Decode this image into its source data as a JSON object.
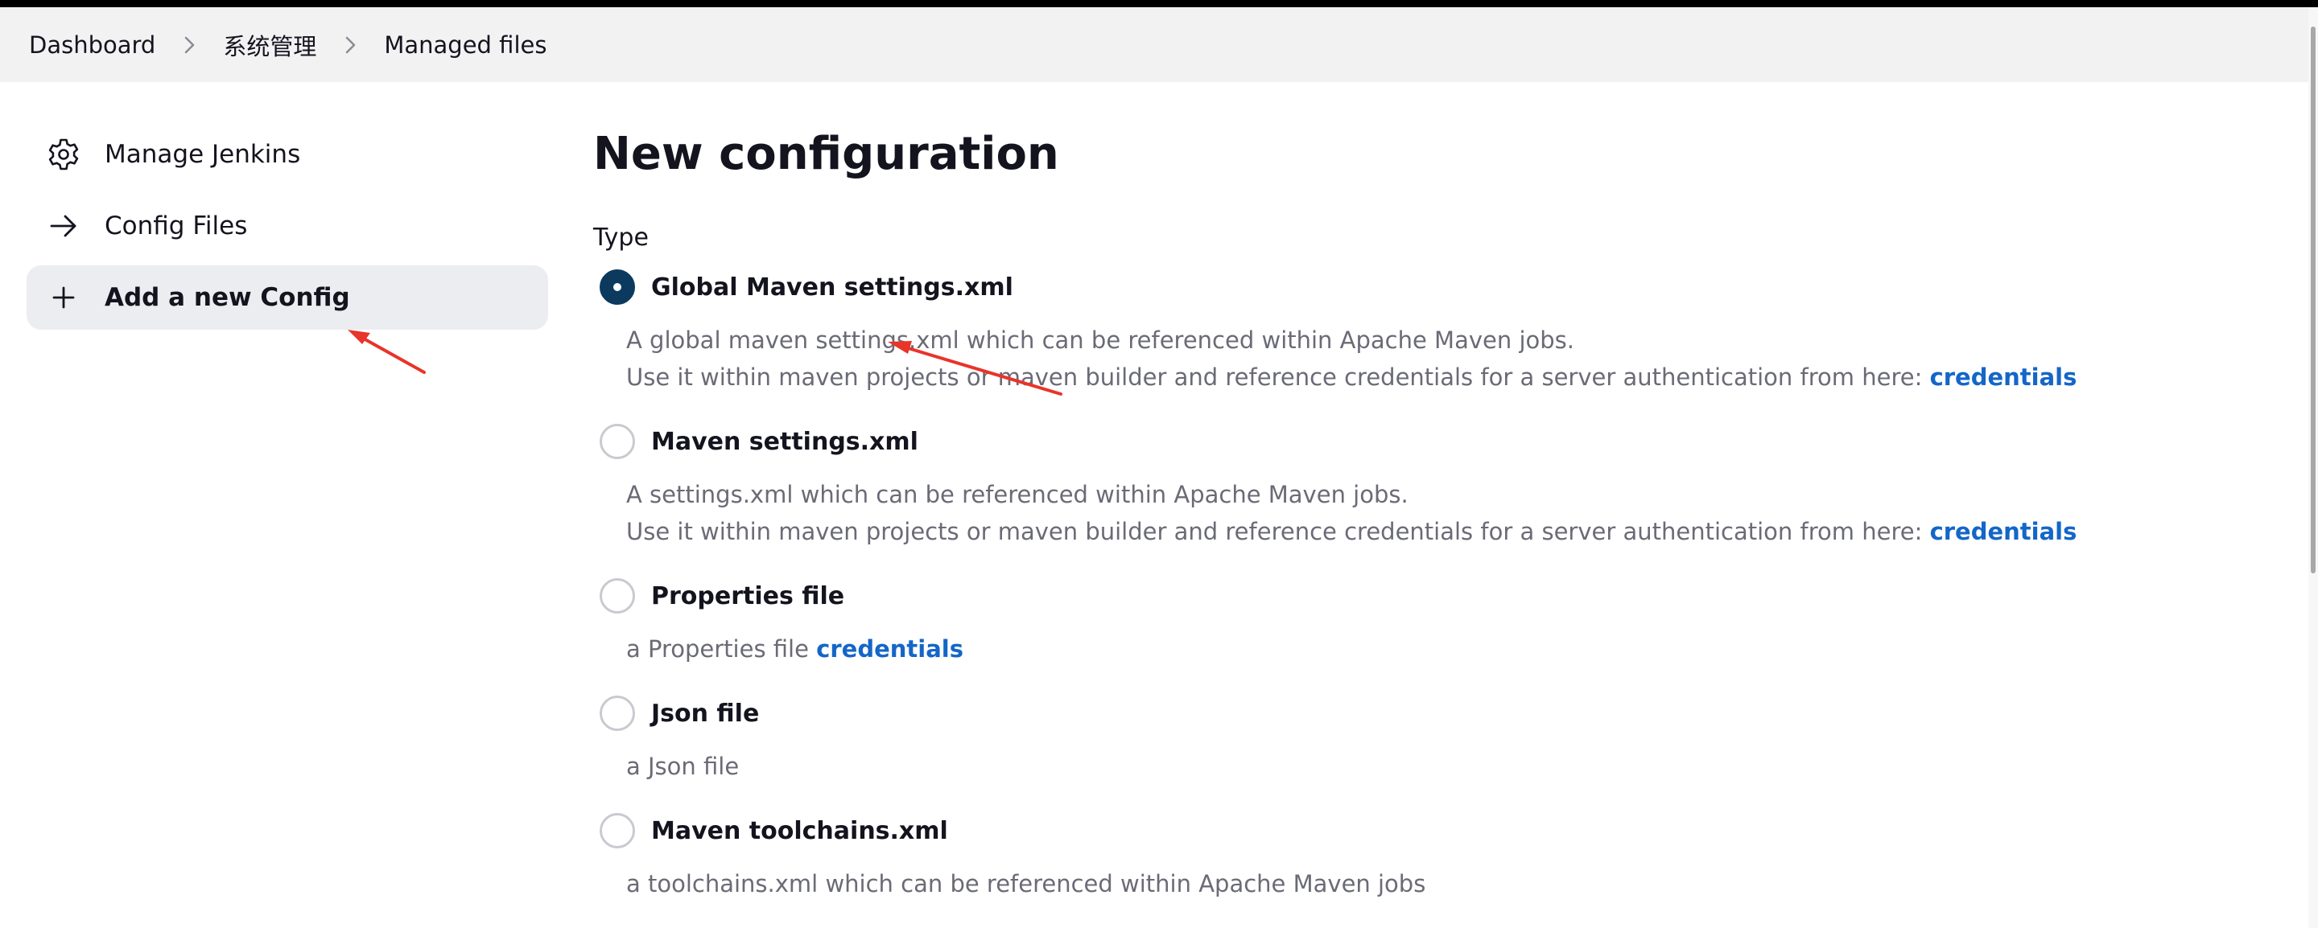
{
  "breadcrumb": {
    "items": [
      "Dashboard",
      "系统管理",
      "Managed files"
    ],
    "separator_icon": "chevron-right-icon"
  },
  "sidebar": {
    "items": [
      {
        "label": "Manage Jenkins",
        "icon": "gear-icon",
        "active": false
      },
      {
        "label": "Config Files",
        "icon": "arrow-right-icon",
        "active": false
      },
      {
        "label": "Add a new Config",
        "icon": "plus-icon",
        "active": true
      }
    ]
  },
  "main": {
    "title": "New configuration",
    "type_label": "Type",
    "options": [
      {
        "title": "Global Maven settings.xml",
        "checked": true,
        "desc_line1": "A global maven settings.xml which can be referenced within Apache Maven jobs.",
        "desc_line2": "Use it within maven projects or maven builder and reference credentials for a server authentication from here:",
        "link": "credentials"
      },
      {
        "title": "Maven settings.xml",
        "checked": false,
        "desc_line1": "A settings.xml which can be referenced within Apache Maven jobs.",
        "desc_line2": "Use it within maven projects or maven builder and reference credentials for a server authentication from here:",
        "link": "credentials"
      },
      {
        "title": "Properties file",
        "checked": false,
        "desc_line1": "a Properties file",
        "link": "credentials"
      },
      {
        "title": "Json file",
        "checked": false,
        "desc_line1": "a Json file"
      },
      {
        "title": "Maven toolchains.xml",
        "checked": false,
        "desc_line1": "a toolchains.xml which can be referenced within Apache Maven jobs"
      }
    ]
  },
  "colors": {
    "accent_link": "#1466c8",
    "radio_checked": "#0b3a5e",
    "annotation_arrow": "#e8342a",
    "active_item_bg": "#ecedf0",
    "breadcrumb_bg": "#f2f2f3"
  }
}
